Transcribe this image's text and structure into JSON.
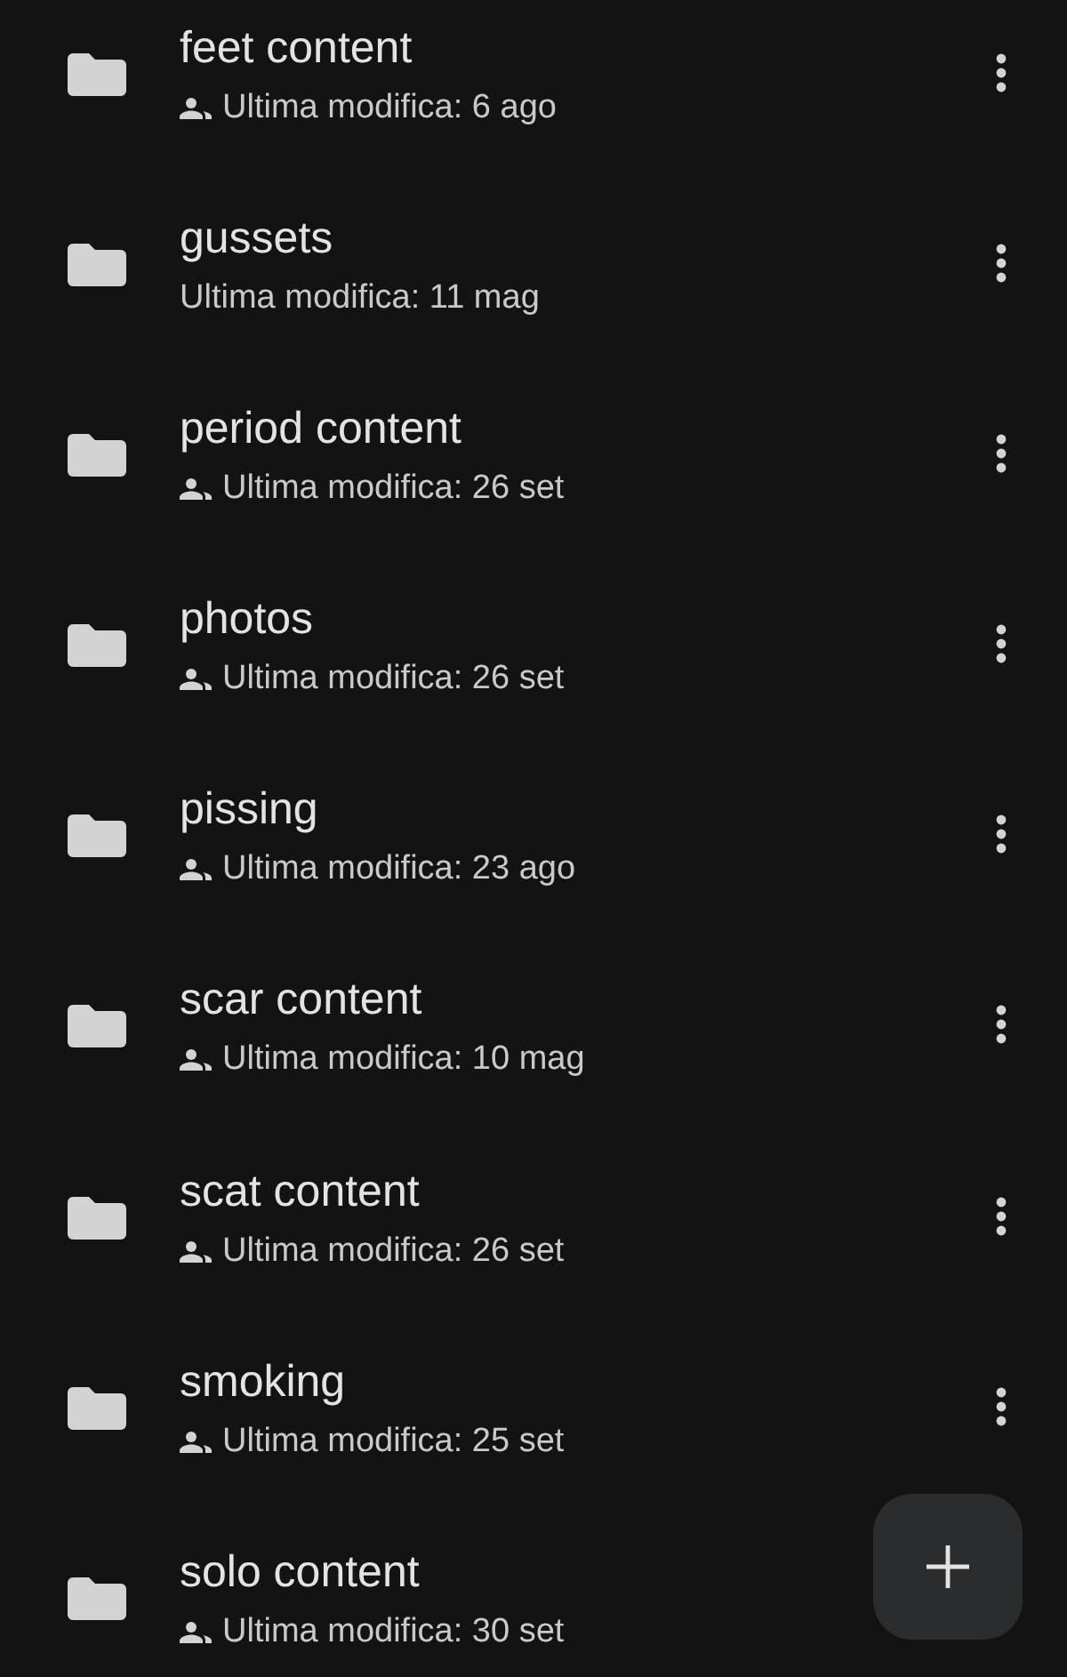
{
  "folders": [
    {
      "name": "feet content",
      "shared": true,
      "modified": "Ultima modifica: 6 ago"
    },
    {
      "name": "gussets",
      "shared": false,
      "modified": "Ultima modifica: 11 mag"
    },
    {
      "name": "period content",
      "shared": true,
      "modified": "Ultima modifica: 26 set"
    },
    {
      "name": "photos",
      "shared": true,
      "modified": "Ultima modifica: 26 set"
    },
    {
      "name": "pissing",
      "shared": true,
      "modified": "Ultima modifica: 23 ago"
    },
    {
      "name": "scar content",
      "shared": true,
      "modified": "Ultima modifica: 10 mag"
    },
    {
      "name": "scat content",
      "shared": true,
      "modified": "Ultima modifica: 26 set"
    },
    {
      "name": "smoking",
      "shared": true,
      "modified": "Ultima modifica: 25 set"
    },
    {
      "name": "solo content",
      "shared": true,
      "modified": "Ultima modifica: 30 set"
    }
  ]
}
